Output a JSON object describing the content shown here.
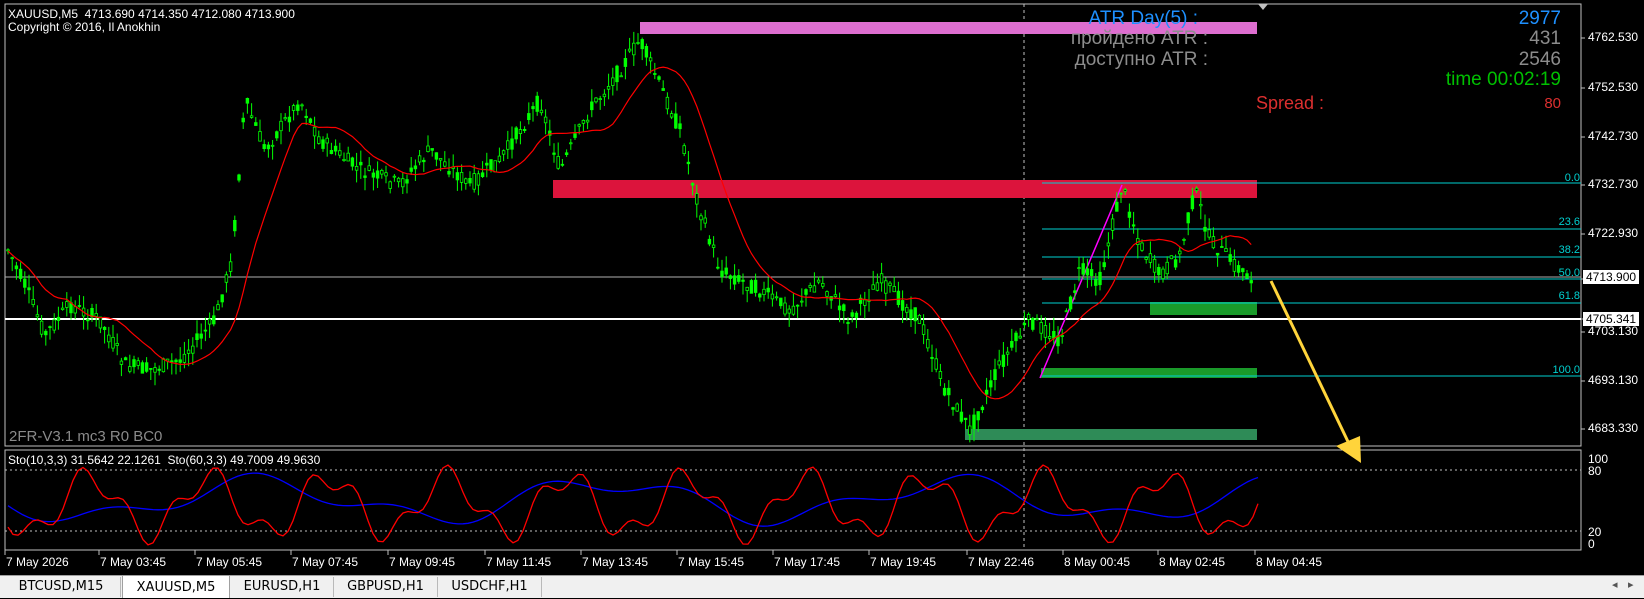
{
  "chart": {
    "header_line1": "XAUUSD,M5  4713.690 4714.350 4712.080 4713.900",
    "header_line2": "Copyright © 2016, Il Anokhin",
    "expert_label": "2FR-V3.1 mc3 R0 BC0",
    "colors": {
      "background": "#000000",
      "candle": "#00ff00",
      "ma": "#ff0000",
      "fib": "#00d0d0",
      "grid": "#c0c0c0",
      "resistance_red": "#dc143c",
      "resistance_pink": "#dd6ecf",
      "support_green": "#1a9a2a",
      "support_green2": "#2e8b57",
      "arrow": "#ffd43b",
      "impulse": "#ff00ff",
      "sto_main": "#ff0000",
      "sto_signal": "#0000ff"
    }
  },
  "atr_panel": {
    "atr_label": "ATR Day(5) :",
    "atr_value": "2977",
    "passed_label": "пройдено ATR :",
    "passed_value": "431",
    "avail_label": "доступно ATR :",
    "avail_value": "2546",
    "time_text": "time 00:02:19",
    "spread_label": "Spread :",
    "spread_value": "80"
  },
  "fibonacci": {
    "levels": [
      "0.0",
      "23.6",
      "38.2",
      "50.0",
      "61.8",
      "100.0"
    ]
  },
  "price_axis": {
    "labels": [
      "4762.530",
      "4752.530",
      "4742.730",
      "4732.730",
      "4722.930",
      "4703.130",
      "4693.130",
      "4683.330"
    ],
    "current_price": "4713.900",
    "hline_price": "4705.341"
  },
  "stochastic": {
    "title": "Sto(10,3,3) 31.5642 22.1261  Sto(60,3,3) 49.7009 49.9630",
    "levels": [
      "100",
      "80",
      "20",
      "0"
    ]
  },
  "time_axis": {
    "labels": [
      "7 May 2026",
      "7 May 03:45",
      "7 May 05:45",
      "7 May 07:45",
      "7 May 09:45",
      "7 May 11:45",
      "7 May 13:45",
      "7 May 15:45",
      "7 May 17:45",
      "7 May 19:45",
      "7 May 22:46",
      "8 May 00:45",
      "8 May 02:45",
      "8 May 04:45"
    ]
  },
  "tabs": [
    {
      "label": "BTCUSD,M15",
      "active": false
    },
    {
      "label": "XAUUSD,M5",
      "active": true
    },
    {
      "label": "EURUSD,H1",
      "active": false
    },
    {
      "label": "GBPUSD,H1",
      "active": false
    },
    {
      "label": "USDCHF,H1",
      "active": false
    }
  ],
  "chart_data": {
    "type": "line",
    "title": "XAUUSD,M5",
    "series": [
      {
        "name": "XAUUSD,M5",
        "x": [
          "7 May 2026",
          "7 May 03:45",
          "7 May 05:45",
          "7 May 07:45",
          "7 May 09:45",
          "7 May 11:45",
          "7 May 13:45",
          "7 May 15:45",
          "7 May 17:45",
          "7 May 19:45",
          "7 May 22:46",
          "8 May 00:45",
          "8 May 02:45",
          "8 May 04:45"
        ],
        "values": [
          4715,
          4700,
          4745,
          4738,
          4742,
          4750,
          4760,
          4715,
          4706,
          4705,
          4694,
          4718,
          4725,
          4714
        ]
      }
    ],
    "ylim": [
      4680,
      4768
    ],
    "xlabel": "",
    "ylabel": ""
  }
}
